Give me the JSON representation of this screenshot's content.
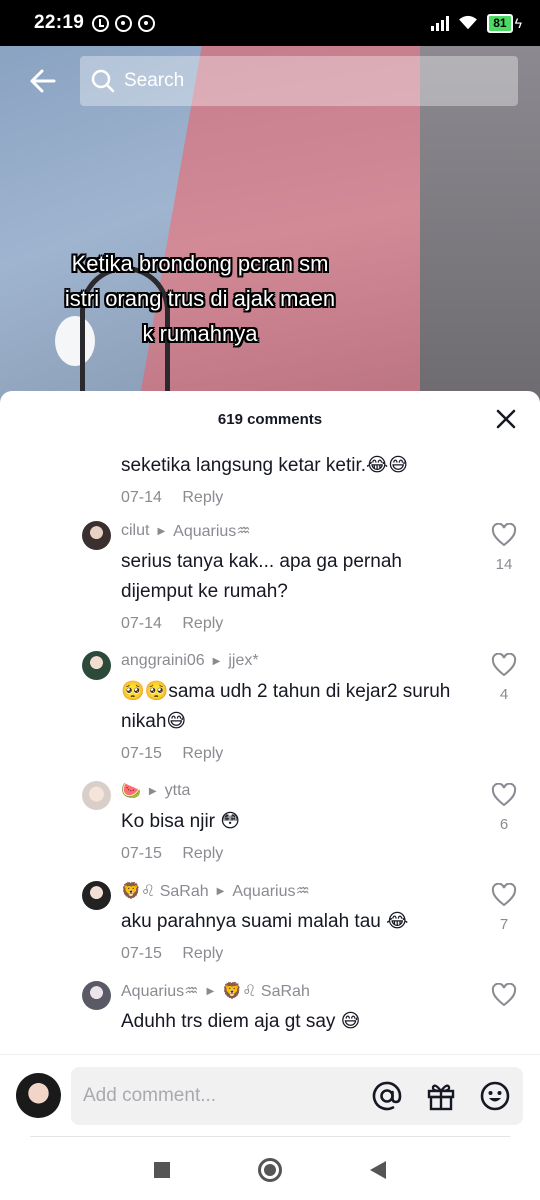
{
  "status_bar": {
    "time": "22:19",
    "battery": "81"
  },
  "search": {
    "placeholder": "Search"
  },
  "video": {
    "caption_lines": [
      "Ketika brondong pcran sm",
      "istri orang trus di ajak maen",
      "k rumahnya"
    ]
  },
  "sheet": {
    "count_label": "619 comments"
  },
  "comments": [
    {
      "user": "",
      "reply_to": "",
      "text": "seketika langsung ketar ketir.😂😅",
      "date": "07-14",
      "reply_label": "Reply",
      "likes": ""
    },
    {
      "user": "cilut",
      "reply_to": "Aquarius♒",
      "text": "serius tanya kak... apa ga pernah dijemput ke rumah?",
      "date": "07-14",
      "reply_label": "Reply",
      "likes": "14"
    },
    {
      "user": "anggraini06",
      "reply_to": "jjex*",
      "text": "🥺🥺sama udh 2 tahun di kejar2 suruh nikah😅",
      "date": "07-15",
      "reply_label": "Reply",
      "likes": "4"
    },
    {
      "user": "🍉",
      "reply_to": "ytta",
      "text": "Ko bisa njir 😳",
      "date": "07-15",
      "reply_label": "Reply",
      "likes": "6"
    },
    {
      "user": "🦁♌ SaRah",
      "reply_to": "Aquarius♒",
      "text": "aku parahnya suami malah tau 😂",
      "date": "07-15",
      "reply_label": "Reply",
      "likes": "7"
    },
    {
      "user": "Aquarius♒",
      "reply_to": "🦁♌ SaRah",
      "text": "Aduhh trs diem aja gt say 😅",
      "date": "",
      "reply_label": "",
      "likes": ""
    }
  ],
  "input": {
    "placeholder": "Add comment..."
  },
  "colors": {
    "text_primary": "#161823",
    "text_secondary": "#8a8b91",
    "battery_green": "#4cd964"
  },
  "icons": [
    "back-arrow-icon",
    "search-icon",
    "close-icon",
    "heart-icon",
    "at-icon",
    "gift-icon",
    "emoji-icon"
  ]
}
